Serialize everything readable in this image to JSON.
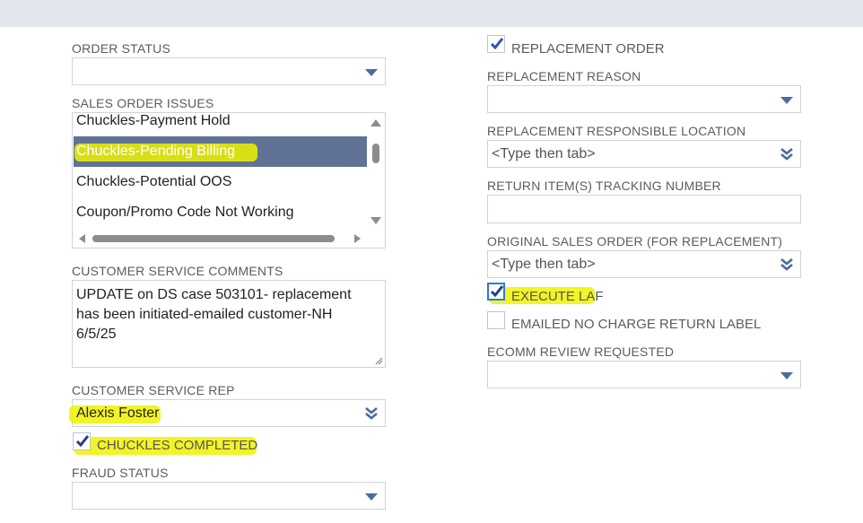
{
  "left": {
    "order_status": {
      "label": "ORDER STATUS",
      "value": ""
    },
    "sales_order_issues": {
      "label": "SALES ORDER ISSUES",
      "items": [
        "Chuckles-Payment Hold",
        "Chuckles-Pending Billing",
        "Chuckles-Potential OOS",
        "Coupon/Promo Code Not Working"
      ],
      "selected": "Chuckles-Pending Billing"
    },
    "customer_service_comments": {
      "label": "CUSTOMER SERVICE COMMENTS",
      "value": "UPDATE on DS case 503101- replacement has been initiated-emailed customer-NH 6/5/25"
    },
    "customer_service_rep": {
      "label": "CUSTOMER SERVICE REP",
      "value": "Alexis Foster"
    },
    "chuckles_completed": {
      "label": "CHUCKLES COMPLETED",
      "checked": true
    },
    "fraud_status": {
      "label": "FRAUD STATUS",
      "value": ""
    }
  },
  "right": {
    "replacement_order": {
      "label": "REPLACEMENT ORDER",
      "checked": true
    },
    "replacement_reason": {
      "label": "REPLACEMENT REASON",
      "value": ""
    },
    "replacement_responsible_location": {
      "label": "REPLACEMENT RESPONSIBLE LOCATION",
      "placeholder": "<Type then tab>"
    },
    "return_tracking": {
      "label": "RETURN ITEM(S) TRACKING NUMBER",
      "value": ""
    },
    "original_sales_order": {
      "label": "ORIGINAL SALES ORDER (FOR REPLACEMENT)",
      "placeholder": "<Type then tab>"
    },
    "execute_laf": {
      "label": "EXECUTE LAF",
      "checked": true
    },
    "emailed_no_charge": {
      "label": "EMAILED NO CHARGE RETURN LABEL",
      "checked": false
    },
    "ecomm_review": {
      "label": "ECOMM REVIEW REQUESTED",
      "value": ""
    }
  },
  "colors": {
    "accent": "#4b6d9c",
    "selected_row": "#607396",
    "highlight": "#eef200",
    "check": "#1f3f8a"
  }
}
